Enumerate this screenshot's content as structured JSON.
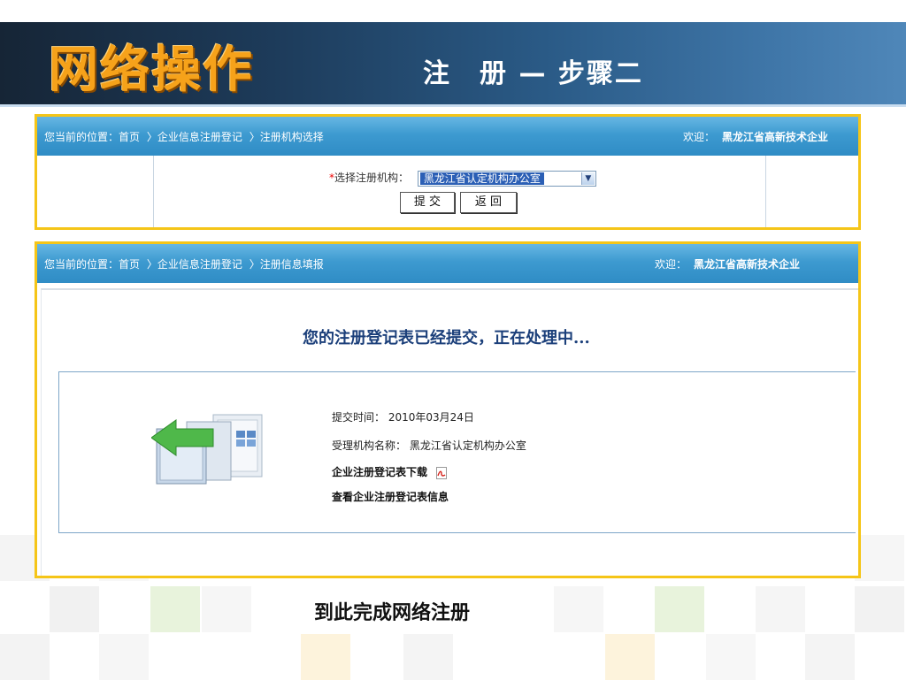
{
  "header": {
    "title": "网络操作",
    "subtitle": "注　册 — 步骤二"
  },
  "panel1": {
    "breadcrumb": [
      "您当前的位置：首页",
      "〉企业信息注册登记",
      "〉注册机构选择"
    ],
    "welcome_label": "欢迎：",
    "welcome_user": "黑龙江省高新技术企业",
    "form": {
      "required_mark": "*",
      "label": "选择注册机构：",
      "selected_value": "黑龙江省认定机构办公室"
    },
    "buttons": {
      "submit": "提 交",
      "back": "返 回"
    }
  },
  "panel2": {
    "breadcrumb": [
      "您当前的位置：首页",
      "〉企业信息注册登记",
      "〉注册信息填报"
    ],
    "welcome_label": "欢迎：",
    "welcome_user": "黑龙江省高新技术企业",
    "status_message": "您的注册登记表已经提交，正在处理中...",
    "info": {
      "submit_time": "提交时间：  2010年03月24日",
      "agency": "受理机构名称：  黑龙江省认定机构办公室",
      "download_link": "企业注册登记表下载",
      "view_link": "查看企业注册登记表信息"
    }
  },
  "footer_text": "到此完成网络注册",
  "colors": {
    "panel_border": "#f5c518",
    "bar_blue": "#3d9ad0",
    "title_orange": "#f6a21a"
  }
}
